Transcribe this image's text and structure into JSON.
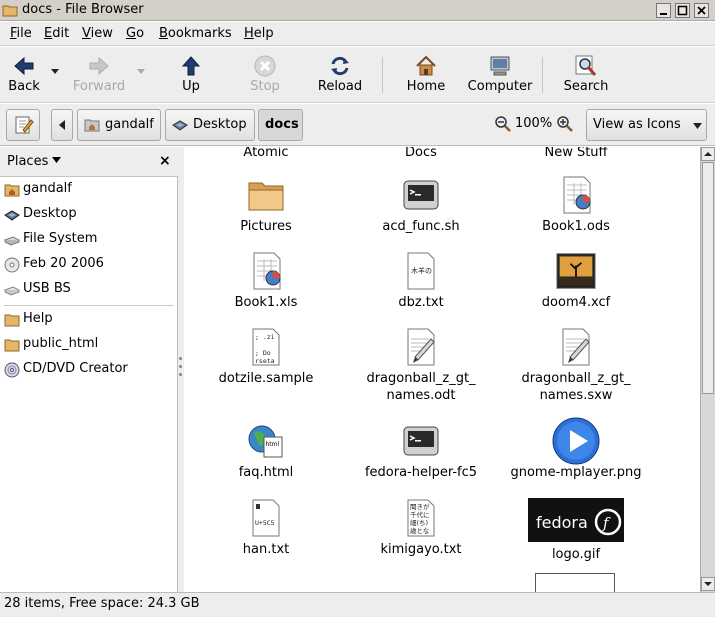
{
  "window": {
    "title": "docs - File Browser"
  },
  "menubar": {
    "items": [
      {
        "label": "File",
        "key": "F",
        "rest": "ile"
      },
      {
        "label": "Edit",
        "key": "E",
        "rest": "dit"
      },
      {
        "label": "View",
        "key": "V",
        "rest": "iew"
      },
      {
        "label": "Go",
        "key": "G",
        "rest": "o"
      },
      {
        "label": "Bookmarks",
        "key": "B",
        "rest": "ookmarks"
      },
      {
        "label": "Help",
        "key": "H",
        "rest": "elp"
      }
    ]
  },
  "toolbar": {
    "back": "Back",
    "forward": "Forward",
    "up": "Up",
    "stop": "Stop",
    "reload": "Reload",
    "home": "Home",
    "computer": "Computer",
    "search": "Search"
  },
  "location": {
    "path": [
      "gandalf",
      "Desktop",
      "docs"
    ],
    "zoom": "100%",
    "view_mode": "View as Icons"
  },
  "sidebar": {
    "title": "Places",
    "close": "×",
    "places": [
      {
        "label": "gandalf",
        "icon": "home-folder-icon"
      },
      {
        "label": "Desktop",
        "icon": "desktop-icon"
      },
      {
        "label": "File System",
        "icon": "drive-icon"
      },
      {
        "label": "Feb 20 2006",
        "icon": "cdrom-icon"
      },
      {
        "label": "USB BS",
        "icon": "usb-drive-icon"
      }
    ],
    "bookmarks": [
      {
        "label": "Help",
        "icon": "folder-icon"
      },
      {
        "label": "public_html",
        "icon": "folder-icon"
      },
      {
        "label": "CD/DVD Creator",
        "icon": "cd-burner-icon"
      }
    ]
  },
  "files": {
    "partial": [
      "Atomic",
      "Docs",
      "New Stuff"
    ],
    "items": [
      {
        "name": "Pictures",
        "type": "folder"
      },
      {
        "name": "acd_func.sh",
        "type": "script"
      },
      {
        "name": "Book1.ods",
        "type": "spreadsheet"
      },
      {
        "name": "Book1.xls",
        "type": "spreadsheet"
      },
      {
        "name": "dbz.txt",
        "type": "text-jp"
      },
      {
        "name": "doom4.xcf",
        "type": "image-xcf"
      },
      {
        "name": "dotzile.sample",
        "type": "text-sample"
      },
      {
        "name": "dragonball_z_gt_",
        "name2": "names.odt",
        "type": "document"
      },
      {
        "name": "dragonball_z_gt_",
        "name2": "names.sxw",
        "type": "document"
      },
      {
        "name": "faq.html",
        "type": "html"
      },
      {
        "name": "fedora-helper-fc5",
        "type": "script"
      },
      {
        "name": "gnome-mplayer.png",
        "type": "png-play"
      },
      {
        "name": "han.txt",
        "type": "text-han"
      },
      {
        "name": "kimigayo.txt",
        "type": "text-kimigayo"
      },
      {
        "name": "logo.gif",
        "type": "fedora-logo"
      }
    ],
    "thumb_texts": {
      "dbz": "木羊の",
      "dotzile_1": "; .zi",
      "dotzile_2": "; Do",
      "dotzile_3": "rseta",
      "han": "U+5C5",
      "kimigayo_1": "聞きが",
      "kimigayo_2": "千代に",
      "kimigayo_3": "細(ち)",
      "kimigayo_4": "歳とな",
      "fedora": "fedora"
    }
  },
  "status": {
    "text": "28 items, Free space: 24.3 GB"
  },
  "colors": {
    "chrome": "#ededed",
    "accent": "#3465a4",
    "folder": "#e7b566"
  }
}
